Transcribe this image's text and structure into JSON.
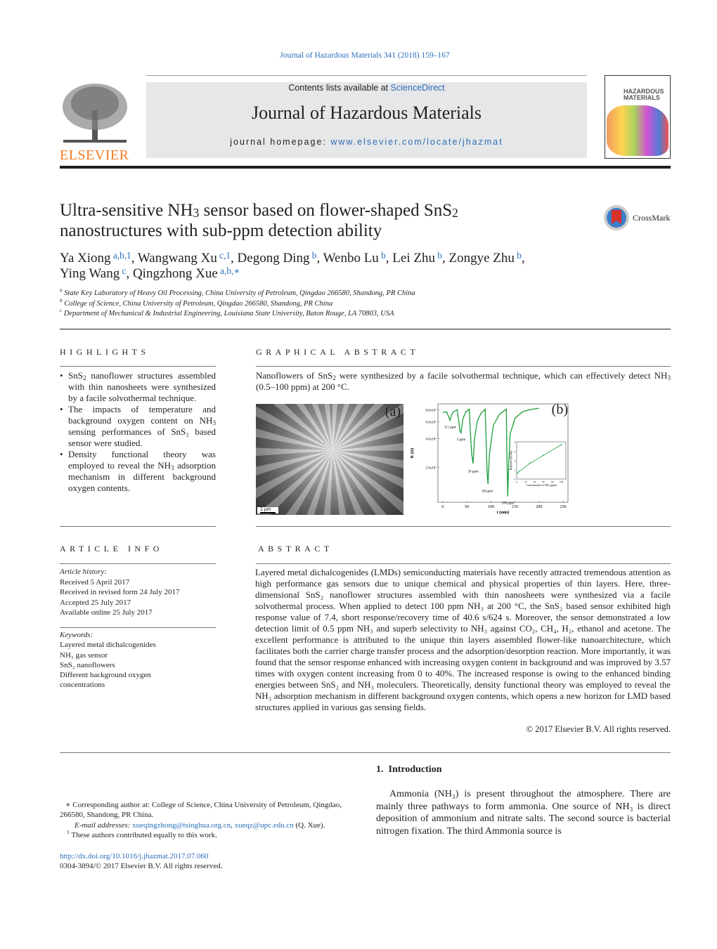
{
  "journal_ref": "Journal of Hazardous Materials 341 (2018) 159–167",
  "masthead": {
    "contents_prefix": "Contents lists available at ",
    "contents_link": "ScienceDirect",
    "journal_title": "Journal of Hazardous Materials",
    "homepage_prefix": "journal homepage: ",
    "homepage_url": "www.elsevier.com/locate/jhazmat",
    "publisher_logo": "ELSEVIER",
    "cover_title": "HAZARDOUS MATERIALS",
    "colors": {
      "accent": "#2a6ebb",
      "elsevier_orange": "#f47920",
      "masthead_bg": "#e6e7e8"
    }
  },
  "article": {
    "title_line1_a": "Ultra-sensitive NH",
    "title_line1_sub": "3",
    "title_line1_b": " sensor based on flower-shaped SnS",
    "title_line1_sub2": "2",
    "title_line2": "nanostructures with sub-ppm detection ability",
    "crossmark": "CrossMark",
    "authors": [
      {
        "name": "Ya Xiong",
        "sup": "a,b,1"
      },
      {
        "name": "Wangwang Xu",
        "sup": "c,1"
      },
      {
        "name": "Degong Ding",
        "sup": "b"
      },
      {
        "name": "Wenbo Lu",
        "sup": "b"
      },
      {
        "name": "Lei Zhu",
        "sup": "b"
      },
      {
        "name": "Zongye Zhu",
        "sup": "b"
      },
      {
        "name": "Ying Wang",
        "sup": "c"
      },
      {
        "name": "Qingzhong Xue",
        "sup": "a,b,∗"
      }
    ],
    "affiliations": [
      {
        "mark": "a",
        "text": "State Key Laboratory of Heavy Oil Processing, China University of Petroleum, Qingdao 266580, Shandong, PR China"
      },
      {
        "mark": "b",
        "text": "College of Science, China University of Petroleum, Qingdao 266580, Shandong, PR China"
      },
      {
        "mark": "c",
        "text": "Department of Mechanical & Industrial Engineering, Louisiana State University, Baton Rouge, LA 70803, USA"
      }
    ]
  },
  "highlights": {
    "heading": "HIGHLIGHTS",
    "items": [
      [
        "SnS",
        "2",
        " nanoflower structures assembled with thin nanosheets were synthesized by a facile solvothermal technique."
      ],
      [
        "The impacts of temperature and background oxygen content on NH",
        "3",
        " sensing performances of SnS₂ based sensor were studied."
      ],
      [
        "Density functional theory was employed to reveal the NH",
        "3",
        " adsorption mechanism in different background oxygen contents."
      ]
    ]
  },
  "graphical_abstract": {
    "heading": "GRAPHICAL ABSTRACT",
    "text_a": "Nanoflowers of SnS",
    "text_sub": "2",
    "text_b": " were synthesized by a facile solvothermal technique, which can effectively detect NH",
    "text_sub2": "3",
    "text_c": " (0.5–100 ppm) at 200 °C.",
    "panel_a_label": "(a)",
    "scale_bar": "1 μm",
    "panel_b_label": "(b)"
  },
  "chart_data": {
    "type": "line",
    "xlabel": "t (min)",
    "ylabel": "R (Ω)",
    "xlim": [
      -10,
      260
    ],
    "ylim": [
      8700000,
      92000000
    ],
    "yscale": "log",
    "xticks": [
      0,
      50,
      100,
      150,
      200,
      250
    ],
    "yticks": [
      {
        "v": 20000000,
        "label": "2.0x10⁷"
      },
      {
        "v": 40000000,
        "label": "4.0x10⁷"
      },
      {
        "v": 60000000,
        "label": "6.0x10⁷"
      },
      {
        "v": 80000000,
        "label": "8.0x10⁷"
      }
    ],
    "series_color": "#1a9e3a",
    "x": [
      0,
      8,
      12,
      15,
      18,
      22,
      30,
      33,
      36,
      38,
      42,
      48,
      55,
      57,
      60,
      63,
      66,
      72,
      80,
      88,
      90,
      92,
      94,
      97,
      105,
      118,
      132,
      133,
      135,
      137,
      140,
      150,
      165,
      180,
      200
    ],
    "y": [
      75000000,
      76000000,
      68000000,
      62000000,
      70000000,
      76000000,
      80000000,
      62000000,
      47000000,
      46000000,
      65000000,
      76000000,
      81000000,
      50000000,
      28000000,
      22000000,
      40000000,
      62000000,
      74000000,
      81000000,
      40000000,
      18000000,
      13500000,
      28000000,
      55000000,
      72000000,
      81000000,
      30000000,
      10000000,
      22000000,
      45000000,
      65000000,
      76000000,
      80000000,
      83000000
    ],
    "annotations": [
      {
        "text": "0.5 ppm",
        "x": 16,
        "y": 58000000
      },
      {
        "text": "5 ppm",
        "x": 38,
        "y": 43000000
      },
      {
        "text": "30 ppm",
        "x": 63,
        "y": 20000000
      },
      {
        "text": "60 ppm",
        "x": 93,
        "y": 12500000
      },
      {
        "text": "100 ppm",
        "x": 135,
        "y": 9400000
      }
    ],
    "inset": {
      "type": "line",
      "xlabel": "Concentration of NH₃ (ppm)",
      "ylabel": "Response (Ra/Rg)",
      "xlim": [
        0,
        110
      ],
      "ylim": [
        0,
        8
      ],
      "xticks": [
        0,
        20,
        40,
        60,
        80,
        100
      ],
      "yticks": [
        0,
        2,
        4,
        6,
        8
      ],
      "x": [
        0.5,
        5,
        30,
        60,
        100
      ],
      "y": [
        1.2,
        1.6,
        3.4,
        5.1,
        7.4
      ]
    }
  },
  "article_info": {
    "heading": "ARTICLE INFO",
    "history_label": "Article history:",
    "history": [
      "Received 5 April 2017",
      "Received in revised form 24 July 2017",
      "Accepted 25 July 2017",
      "Available online 25 July 2017"
    ],
    "keywords_label": "Keywords:",
    "keywords": [
      "Layered metal dichalcogenides",
      "NH₃ gas sensor",
      "SnS₂ nanoflowers",
      "Different background oxygen",
      "concentrations"
    ]
  },
  "abstract": {
    "heading": "ABSTRACT",
    "text": "Layered metal dichalcogenides (LMDs) semiconducting materials have recently attracted tremendous attention as high performance gas sensors due to unique chemical and physical properties of thin layers. Here, three-dimensional SnS₂ nanoflower structures assembled with thin nanosheets were synthesized via a facile solvothermal process. When applied to detect 100 ppm NH₃ at 200 °C, the SnS₂ based sensor exhibited high response value of 7.4, short response/recovery time of 40.6 s/624 s. Moreover, the sensor demonstrated a low detection limit of 0.5 ppm NH₃ and superb selectivity to NH₃ against CO₂, CH₄, H₂, ethanol and acetone. The excellent performance is attributed to the unique thin layers assembled flower-like nanoarchitecture, which facilitates both the carrier charge transfer process and the adsorption/desorption reaction. More importantly, it was found that the sensor response enhanced with increasing oxygen content in background and was improved by 3.57 times with oxygen content increasing from 0 to 40%. The increased response is owing to the enhanced binding energies between SnS₂ and NH₃ moleculers. Theoretically, density functional theory was employed to reveal the NH₃ adsorption mechanism in different background oxygen contents, which opens a new horizon for LMD based structures applied in various gas sensing fields.",
    "copyright": "© 2017 Elsevier B.V. All rights reserved."
  },
  "footnotes": {
    "corresponding": "∗  Corresponding author at: College of Science, China University of Petroleum, Qingdao, 266580, Shandong, PR China.",
    "email_label": "E-mail addresses: ",
    "email1": "xueqingzhong@tsinghua.org.cn",
    "email_sep": ", ",
    "email2": "xueqz@upc.edu.cn",
    "email_suffix": " (Q. Xue).",
    "equal": "These authors contributed equally to this work.",
    "equal_mark": "1",
    "doi": "http://dx.doi.org/10.1016/j.jhazmat.2017.07.060",
    "issn": "0304-3894/© 2017 Elsevier B.V. All rights reserved."
  },
  "introduction": {
    "heading": "1.  Introduction",
    "text": "Ammonia (NH₃) is present throughout the atmosphere. There are mainly three pathways to form ammonia. One source of NH₃ is direct deposition of ammonium and nitrate salts. The second source is bacterial nitrogen fixation. The third Ammonia source is"
  }
}
